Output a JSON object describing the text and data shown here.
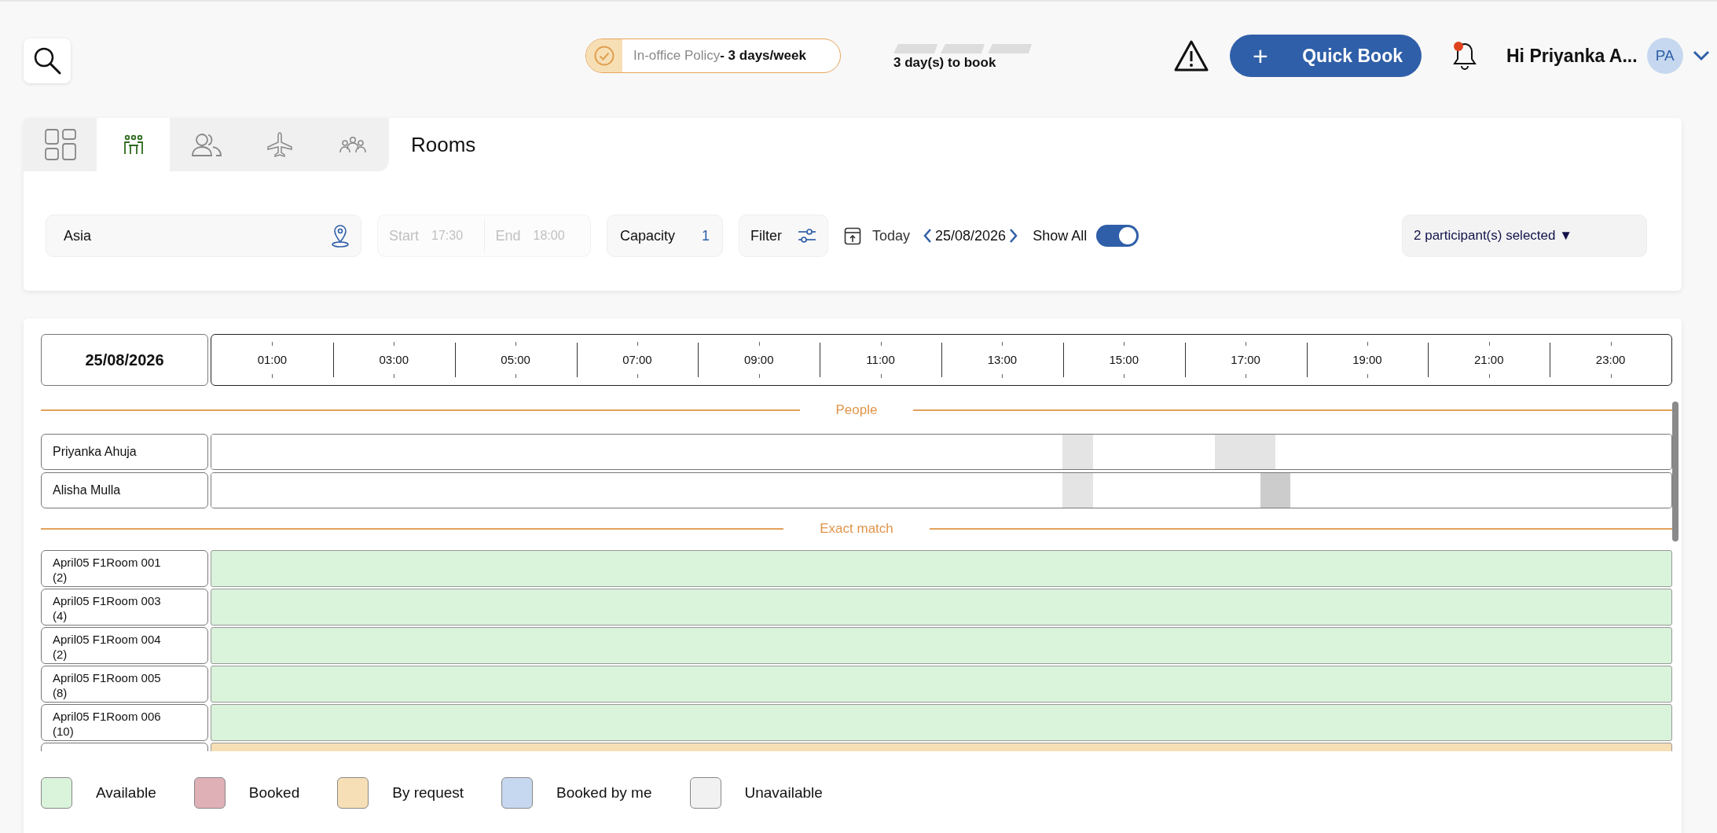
{
  "top_bar": {
    "policy": "In-office Policy**- 3 days/week**",
    "days_to_book": "3 day(s) to book",
    "quick_book": {
      "icon": "+",
      "label": "Quick Book"
    },
    "notifications": {
      "unread": true
    },
    "greeting": "Hi Priyanka A...",
    "avatar": "PA"
  },
  "rooms_panel": {
    "tabs": [
      {
        "kind": "dashboard",
        "selected": false
      },
      {
        "kind": "rooms",
        "selected": true
      },
      {
        "kind": "people",
        "selected": false
      },
      {
        "kind": "travel",
        "selected": false
      },
      {
        "kind": "groups",
        "selected": false
      }
    ],
    "title": "Rooms",
    "location": "Asia",
    "time_range": {
      "start_label": "Start",
      "start": "17:30",
      "end_label": "End",
      "end": "18:00",
      "disabled": true
    },
    "capacity": {
      "label": "Capacity",
      "value": "1"
    },
    "filter": "Filter",
    "today": "Today",
    "date": "25/08/2026",
    "show_all": {
      "label": "Show All",
      "on": true
    },
    "participants": "2 participant(s) selected ▼"
  },
  "schedule": {
    "date": "25/08/2026",
    "time_labels": [
      "01:00",
      "03:00",
      "05:00",
      "07:00",
      "09:00",
      "11:00",
      "13:00",
      "15:00",
      "17:00",
      "19:00",
      "21:00",
      "23:00"
    ],
    "people_heading": "People",
    "people": [
      {
        "name": "Priyanka Ahuja",
        "slots": [
          {
            "kind": "free"
          },
          {
            "kind": "free"
          },
          {
            "kind": "free"
          },
          {
            "kind": "free"
          },
          {
            "kind": "free"
          },
          {
            "kind": "free"
          },
          {
            "kind": "free"
          },
          {
            "kind": "free"
          },
          {
            "kind": "free"
          },
          {
            "kind": "free"
          },
          {
            "kind": "free"
          },
          {
            "kind": "free"
          },
          {
            "kind": "free"
          },
          {
            "kind": "free"
          },
          {
            "kind": "free"
          },
          {
            "kind": "free"
          },
          {
            "kind": "free"
          },
          {
            "kind": "free"
          },
          {
            "kind": "free"
          },
          {
            "kind": "free"
          },
          {
            "kind": "free"
          },
          {
            "kind": "free"
          },
          {
            "kind": "free"
          },
          {
            "kind": "free"
          },
          {
            "kind": "free"
          },
          {
            "kind": "free"
          },
          {
            "kind": "free"
          },
          {
            "kind": "free"
          },
          {
            "kind": "free"
          },
          {
            "kind": "free"
          },
          {
            "kind": "free"
          },
          {
            "kind": "free"
          },
          {
            "kind": "free"
          },
          {
            "kind": "free"
          },
          {
            "kind": "free"
          },
          {
            "kind": "free"
          },
          {
            "kind": "free"
          },
          {
            "kind": "free"
          },
          {
            "kind": "free"
          },
          {
            "kind": "free"
          },
          {
            "kind": "free"
          },
          {
            "kind": "free"
          },
          {
            "kind": "free"
          },
          {
            "kind": "free"
          },
          {
            "kind": "free"
          },
          {
            "kind": "free"
          },
          {
            "kind": "free"
          },
          {
            "kind": "free"
          },
          {
            "kind": "free"
          },
          {
            "kind": "free"
          },
          {
            "kind": "free"
          },
          {
            "kind": "free"
          },
          {
            "kind": "free"
          },
          {
            "kind": "free"
          },
          {
            "kind": "free"
          },
          {
            "kind": "free"
          },
          {
            "kind": "busy"
          },
          {
            "kind": "busy"
          },
          {
            "kind": "free"
          },
          {
            "kind": "free"
          },
          {
            "kind": "free"
          },
          {
            "kind": "free"
          },
          {
            "kind": "free"
          },
          {
            "kind": "free"
          },
          {
            "kind": "free"
          },
          {
            "kind": "free"
          },
          {
            "kind": "busy"
          },
          {
            "kind": "busy"
          },
          {
            "kind": "busy"
          },
          {
            "kind": "busy"
          },
          {
            "kind": "free"
          },
          {
            "kind": "free"
          },
          {
            "kind": "free"
          },
          {
            "kind": "free"
          },
          {
            "kind": "free"
          },
          {
            "kind": "free"
          },
          {
            "kind": "free"
          },
          {
            "kind": "free"
          },
          {
            "kind": "free"
          },
          {
            "kind": "free"
          },
          {
            "kind": "free"
          },
          {
            "kind": "free"
          },
          {
            "kind": "free"
          },
          {
            "kind": "free"
          },
          {
            "kind": "free"
          },
          {
            "kind": "free"
          },
          {
            "kind": "free"
          },
          {
            "kind": "free"
          },
          {
            "kind": "free"
          },
          {
            "kind": "free"
          },
          {
            "kind": "free"
          },
          {
            "kind": "free"
          },
          {
            "kind": "free"
          },
          {
            "kind": "free"
          },
          {
            "kind": "free"
          },
          {
            "kind": "free"
          }
        ]
      },
      {
        "name": "Alisha Mulla",
        "slots": [
          {
            "kind": "free"
          },
          {
            "kind": "free"
          },
          {
            "kind": "free"
          },
          {
            "kind": "free"
          },
          {
            "kind": "free"
          },
          {
            "kind": "free"
          },
          {
            "kind": "free"
          },
          {
            "kind": "free"
          },
          {
            "kind": "free"
          },
          {
            "kind": "free"
          },
          {
            "kind": "free"
          },
          {
            "kind": "free"
          },
          {
            "kind": "free"
          },
          {
            "kind": "free"
          },
          {
            "kind": "free"
          },
          {
            "kind": "free"
          },
          {
            "kind": "free"
          },
          {
            "kind": "free"
          },
          {
            "kind": "free"
          },
          {
            "kind": "free"
          },
          {
            "kind": "free"
          },
          {
            "kind": "free"
          },
          {
            "kind": "free"
          },
          {
            "kind": "free"
          },
          {
            "kind": "free"
          },
          {
            "kind": "free"
          },
          {
            "kind": "free"
          },
          {
            "kind": "free"
          },
          {
            "kind": "free"
          },
          {
            "kind": "free"
          },
          {
            "kind": "free"
          },
          {
            "kind": "free"
          },
          {
            "kind": "free"
          },
          {
            "kind": "free"
          },
          {
            "kind": "free"
          },
          {
            "kind": "free"
          },
          {
            "kind": "free"
          },
          {
            "kind": "free"
          },
          {
            "kind": "free"
          },
          {
            "kind": "free"
          },
          {
            "kind": "free"
          },
          {
            "kind": "free"
          },
          {
            "kind": "free"
          },
          {
            "kind": "free"
          },
          {
            "kind": "free"
          },
          {
            "kind": "free"
          },
          {
            "kind": "free"
          },
          {
            "kind": "free"
          },
          {
            "kind": "free"
          },
          {
            "kind": "free"
          },
          {
            "kind": "free"
          },
          {
            "kind": "free"
          },
          {
            "kind": "free"
          },
          {
            "kind": "free"
          },
          {
            "kind": "free"
          },
          {
            "kind": "free"
          },
          {
            "kind": "busy"
          },
          {
            "kind": "busy"
          },
          {
            "kind": "free"
          },
          {
            "kind": "free"
          },
          {
            "kind": "free"
          },
          {
            "kind": "free"
          },
          {
            "kind": "free"
          },
          {
            "kind": "free"
          },
          {
            "kind": "free"
          },
          {
            "kind": "free"
          },
          {
            "kind": "free"
          },
          {
            "kind": "free"
          },
          {
            "kind": "free"
          },
          {
            "kind": "held"
          },
          {
            "kind": "held"
          },
          {
            "kind": "free"
          },
          {
            "kind": "free"
          },
          {
            "kind": "free"
          },
          {
            "kind": "free"
          },
          {
            "kind": "free"
          },
          {
            "kind": "free"
          },
          {
            "kind": "free"
          },
          {
            "kind": "free"
          },
          {
            "kind": "free"
          },
          {
            "kind": "free"
          },
          {
            "kind": "free"
          },
          {
            "kind": "free"
          },
          {
            "kind": "free"
          },
          {
            "kind": "free"
          },
          {
            "kind": "free"
          },
          {
            "kind": "free"
          },
          {
            "kind": "free"
          },
          {
            "kind": "free"
          },
          {
            "kind": "free"
          },
          {
            "kind": "free"
          },
          {
            "kind": "free"
          },
          {
            "kind": "free"
          },
          {
            "kind": "free"
          },
          {
            "kind": "free"
          },
          {
            "kind": "free"
          }
        ]
      }
    ],
    "rooms_heading": "Exact match",
    "rooms": [
      {
        "name": "April05 F1Room 001",
        "capacity": "(2)",
        "kind": "available"
      },
      {
        "name": "April05 F1Room 003",
        "capacity": "(4)",
        "kind": "available"
      },
      {
        "name": "April05 F1Room 004",
        "capacity": "(2)",
        "kind": "available"
      },
      {
        "name": "April05 F1Room 005",
        "capacity": "(8)",
        "kind": "available"
      },
      {
        "name": "April05 F1Room 006",
        "capacity": "(10)",
        "kind": "available"
      },
      {
        "kind": "by_request"
      }
    ]
  },
  "legend": [
    {
      "label": "Available",
      "color": "#daf3db"
    },
    {
      "label": "Booked",
      "color": "#dfb0b6"
    },
    {
      "label": "By request",
      "color": "#f6dfb6"
    },
    {
      "label": "Booked by me",
      "color": "#c6d8ef"
    },
    {
      "label": "Unavailable",
      "color": "#f1f1f1"
    }
  ]
}
